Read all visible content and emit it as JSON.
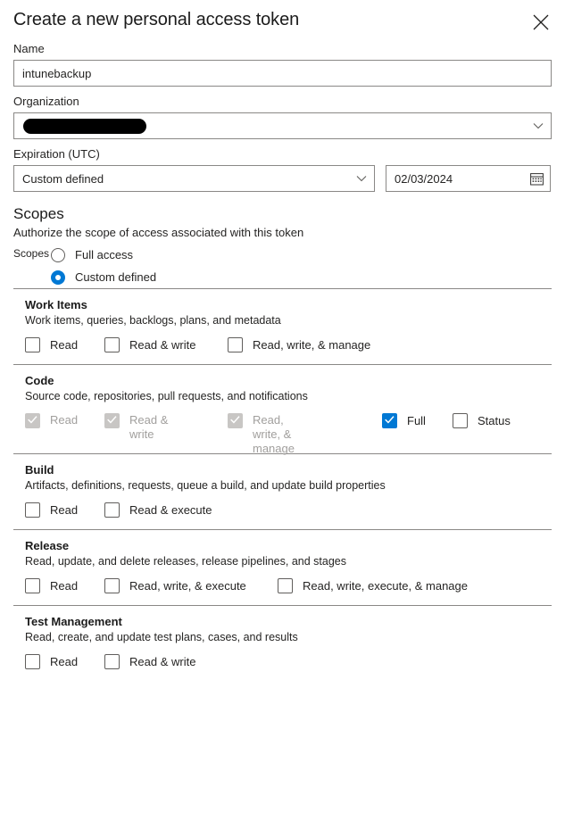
{
  "dialog": {
    "title": "Create a new personal access token",
    "close_icon": "close-icon"
  },
  "form": {
    "name": {
      "label": "Name",
      "value": "intunebackup",
      "placeholder": ""
    },
    "organization": {
      "label": "Organization",
      "value": "",
      "redacted": true,
      "chevron_icon": "chevron-down-icon"
    },
    "expiration": {
      "label": "Expiration (UTC)",
      "value": "Custom defined",
      "chevron_icon": "chevron-down-icon",
      "date_value": "02/03/2024",
      "calendar_icon": "calendar-icon"
    }
  },
  "scopes": {
    "heading": "Scopes",
    "description": "Authorize the scope of access associated with this token",
    "radio_label": "Scopes",
    "options": [
      {
        "label": "Full access",
        "checked": false
      },
      {
        "label": "Custom defined",
        "checked": true
      }
    ]
  },
  "colors": {
    "accent": "#0078d4",
    "border": "#8a8886",
    "disabled": "#c8c6c4",
    "disabled_text": "#a19f9d",
    "text": "#252423"
  },
  "sections": [
    {
      "title": "Work Items",
      "description": "Work items, queries, backlogs, plans, and metadata",
      "options": [
        {
          "label": "Read",
          "checked": false,
          "disabled": false
        },
        {
          "label": "Read & write",
          "checked": false,
          "disabled": false
        },
        {
          "label": "Read, write, & manage",
          "checked": false,
          "disabled": false
        }
      ]
    },
    {
      "title": "Code",
      "description": "Source code, repositories, pull requests, and notifications",
      "options": [
        {
          "label": "Read",
          "checked": true,
          "disabled": true
        },
        {
          "label": "Read & write",
          "checked": true,
          "disabled": true
        },
        {
          "label": "Read, write, & manage",
          "checked": true,
          "disabled": true
        },
        {
          "label": "Full",
          "checked": true,
          "disabled": false
        },
        {
          "label": "Status",
          "checked": false,
          "disabled": false
        }
      ]
    },
    {
      "title": "Build",
      "description": "Artifacts, definitions, requests, queue a build, and update build properties",
      "options": [
        {
          "label": "Read",
          "checked": false,
          "disabled": false
        },
        {
          "label": "Read & execute",
          "checked": false,
          "disabled": false
        }
      ]
    },
    {
      "title": "Release",
      "description": "Read, update, and delete releases, release pipelines, and stages",
      "options": [
        {
          "label": "Read",
          "checked": false,
          "disabled": false
        },
        {
          "label": "Read, write, & execute",
          "checked": false,
          "disabled": false
        },
        {
          "label": "Read, write, execute, & manage",
          "checked": false,
          "disabled": false
        }
      ]
    },
    {
      "title": "Test Management",
      "description": "Read, create, and update test plans, cases, and results",
      "options": [
        {
          "label": "Read",
          "checked": false,
          "disabled": false
        },
        {
          "label": "Read & write",
          "checked": false,
          "disabled": false
        }
      ]
    }
  ]
}
